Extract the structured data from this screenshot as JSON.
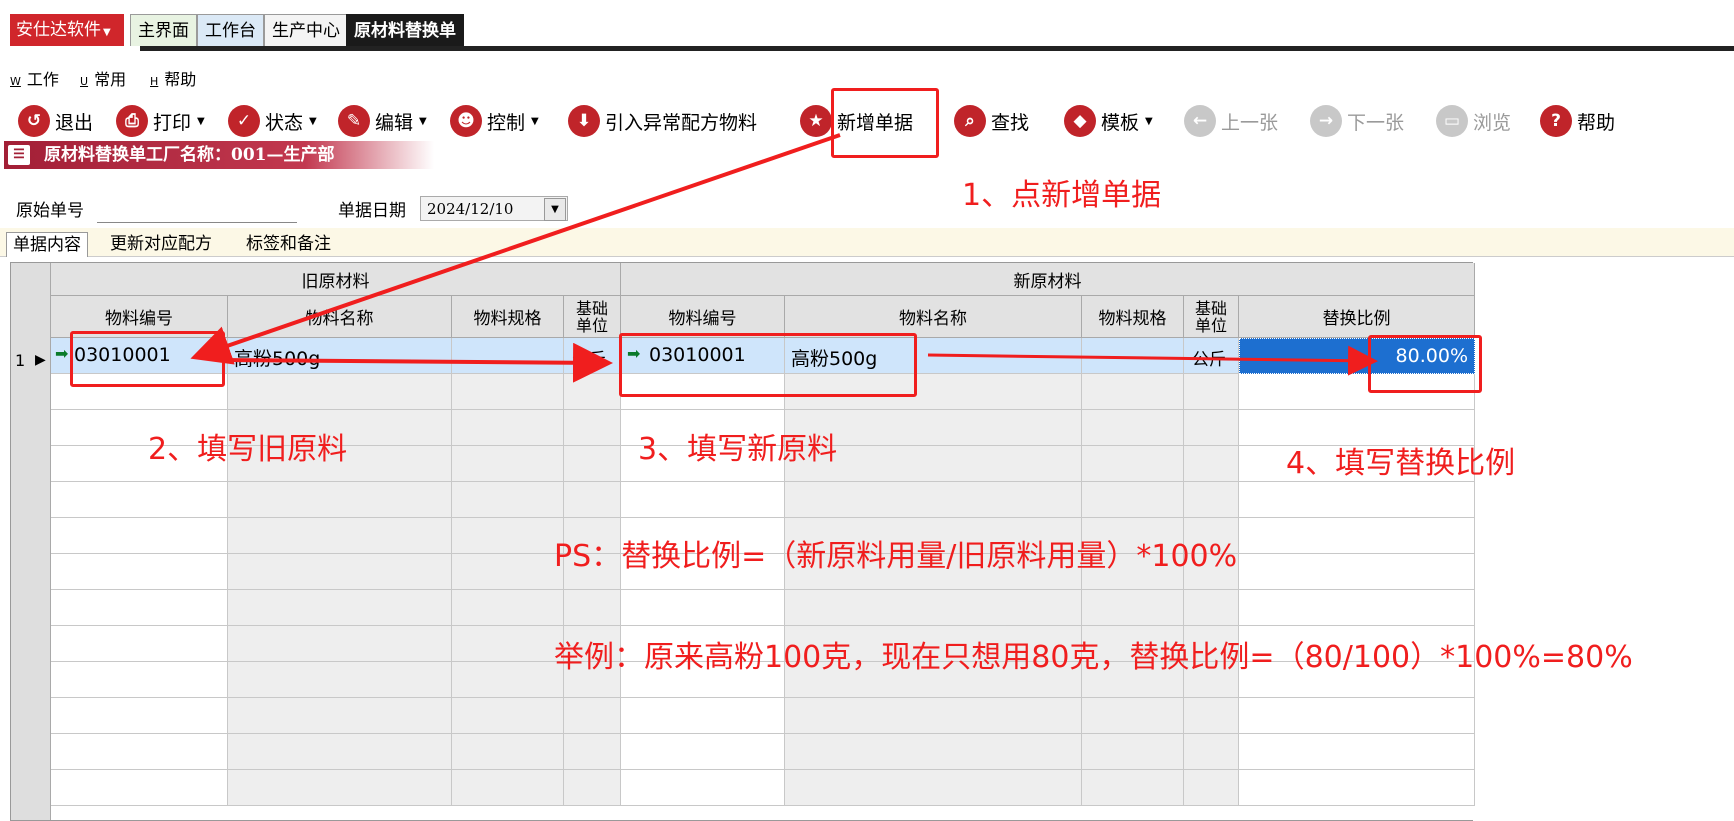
{
  "app": {
    "brand": "安仕达软件",
    "tabs": [
      "主界面",
      "工作台",
      "生产中心",
      "原材料替换单"
    ],
    "active_tab": "原材料替换单"
  },
  "menu": [
    {
      "acc": "W",
      "label": "工作"
    },
    {
      "acc": "U",
      "label": "常用"
    },
    {
      "acc": "H",
      "label": "帮助"
    }
  ],
  "toolbar": [
    {
      "label": "退出",
      "icon": "exit-icon"
    },
    {
      "label": "打印",
      "icon": "print-icon"
    },
    {
      "label": "状态",
      "icon": "check-icon"
    },
    {
      "label": "编辑",
      "icon": "pencil-icon"
    },
    {
      "label": "控制",
      "icon": "user-icon"
    },
    {
      "label": "引入异常配方物料",
      "icon": "download-icon"
    },
    {
      "label": "新增单据",
      "icon": "star-icon"
    },
    {
      "label": "查找",
      "icon": "search-icon"
    },
    {
      "label": "模板",
      "icon": "eraser-icon"
    },
    {
      "label": "上一张",
      "icon": "prev-icon"
    },
    {
      "label": "下一张",
      "icon": "next-icon"
    },
    {
      "label": "浏览",
      "icon": "folder-icon"
    },
    {
      "label": "帮助",
      "icon": "help-icon"
    }
  ],
  "title_strip": "原材料替换单工厂名称：001—生产部",
  "form": {
    "orig_no_label": "原始单号",
    "orig_no_value": "",
    "date_label": "单据日期",
    "date_value": "2024/12/10"
  },
  "subtabs": [
    "单据内容",
    "更新对应配方",
    "标签和备注"
  ],
  "grid": {
    "group_old": "旧原材料",
    "group_new": "新原材料",
    "columns": [
      "物料编号",
      "物料名称",
      "物料规格",
      "基础单位",
      "物料编号",
      "物料名称",
      "物料规格",
      "基础单位",
      "替换比例"
    ],
    "rows": [
      {
        "no": "1",
        "old_code": "03010001",
        "old_name": "高粉500g",
        "old_spec": "",
        "old_unit": "公斤",
        "new_code": "03010001",
        "new_name": "高粉500g",
        "new_spec": "",
        "new_unit": "公斤",
        "ratio": "80.00%"
      }
    ]
  },
  "annotations": {
    "step1": "1、点新增单据",
    "step2": "2、填写旧原料",
    "step3": "3、填写新原料",
    "step4": "4、填写替换比例",
    "ps": "PS：替换比例=（新原料用量/旧原料用量）*100%",
    "example": "举例：原来高粉100克，现在只想用80克，替换比例=（80/100）*100%=80%"
  },
  "colors": {
    "annotation": "#f01e1e",
    "brand": "#d0262b",
    "selected_cell": "#1d6fd0"
  }
}
